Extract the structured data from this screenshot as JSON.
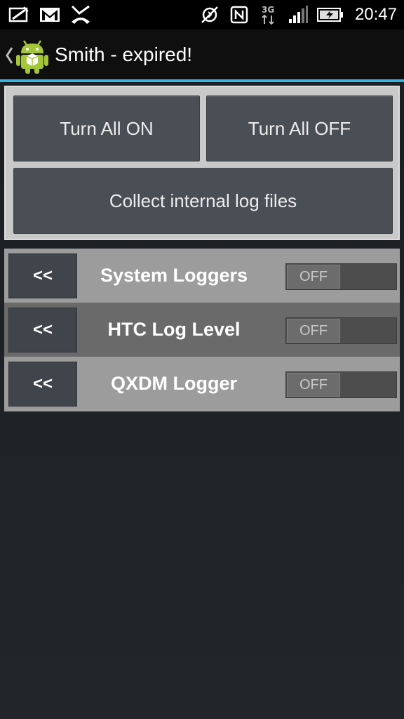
{
  "status_bar": {
    "time": "20:47",
    "left_icons": [
      "image-edit-icon",
      "gmail-icon",
      "missed-call-icon"
    ],
    "right_icons": [
      "sync-off-icon",
      "nfc-icon",
      "network-3g-icon",
      "signal-icon",
      "battery-charging-icon"
    ]
  },
  "action_bar": {
    "title": "Smith - expired!",
    "accent_color": "#33b5e5"
  },
  "controls": {
    "turn_all_on": "Turn All ON",
    "turn_all_off": "Turn All OFF",
    "collect_logs": "Collect internal log files"
  },
  "loggers": [
    {
      "expand_label": "<<",
      "name": "System Loggers",
      "toggle": "OFF"
    },
    {
      "expand_label": "<<",
      "name": "HTC Log Level",
      "toggle": "OFF"
    },
    {
      "expand_label": "<<",
      "name": "QXDM Logger",
      "toggle": "OFF"
    }
  ]
}
